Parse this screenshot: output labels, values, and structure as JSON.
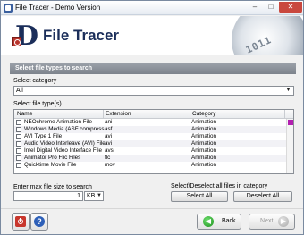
{
  "window": {
    "title": "File Tracer - Demo Version",
    "min": "–",
    "max": "□",
    "close": "✕"
  },
  "header": {
    "product_title": "File Tracer",
    "disk_digits": "1011"
  },
  "section_title": "Select file types to search",
  "category": {
    "label": "Select category",
    "selected": "All"
  },
  "filetypes": {
    "label": "Select file type(s)",
    "columns": [
      "Name",
      "Extension",
      "Category"
    ],
    "rows": [
      {
        "name": "NEOchrome Animation File",
        "ext": "ani",
        "cat": "Animation"
      },
      {
        "name": "Windows Media (ASF compression)",
        "ext": "asf",
        "cat": "Animation"
      },
      {
        "name": "AVI Type 1 File",
        "ext": "avi",
        "cat": "Animation"
      },
      {
        "name": "Audio Video Interleave (AVI) File",
        "ext": "avi",
        "cat": "Animation"
      },
      {
        "name": "Intel Digital Video Interface File",
        "ext": "avs",
        "cat": "Animation"
      },
      {
        "name": "Animator Pro Flic Files",
        "ext": "flc",
        "cat": "Animation"
      },
      {
        "name": "Quicktime Movie File",
        "ext": "mov",
        "cat": "Animation"
      }
    ]
  },
  "max_size": {
    "label": "Enter max file size to search",
    "value": "1",
    "unit": "KB"
  },
  "select_all_area": {
    "label": "Select\\Deselect all files in category",
    "select_all": "Select All",
    "deselect_all": "Deselect All"
  },
  "footer": {
    "back": "Back",
    "next": "Next"
  },
  "colors": {
    "section_bar": "#8a9099",
    "scroll_thumb": "#b21fb0",
    "brand": "#1b2e5a"
  }
}
